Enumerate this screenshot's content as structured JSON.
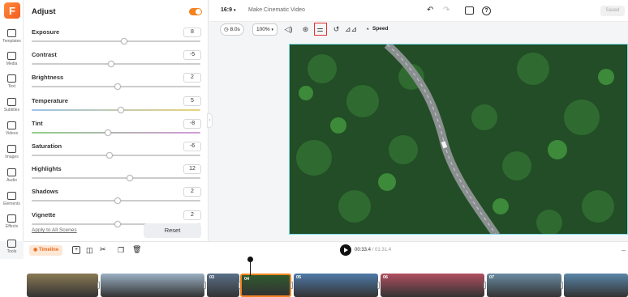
{
  "rail": [
    {
      "label": "Templates",
      "icon": "templates-icon"
    },
    {
      "label": "Media",
      "icon": "media-icon"
    },
    {
      "label": "Text",
      "icon": "text-icon"
    },
    {
      "label": "Subtitles",
      "icon": "subtitles-icon"
    },
    {
      "label": "Videos",
      "icon": "videos-icon"
    },
    {
      "label": "Images",
      "icon": "images-icon"
    },
    {
      "label": "Audio",
      "icon": "audio-icon"
    },
    {
      "label": "Elements",
      "icon": "elements-icon"
    },
    {
      "label": "Effects",
      "icon": "effects-icon"
    },
    {
      "label": "Tools",
      "icon": "tools-icon"
    }
  ],
  "logo": "F",
  "panel": {
    "title": "Adjust",
    "toggle_on": true,
    "rows": [
      {
        "label": "Exposure",
        "value": "8",
        "level": 0.55
      },
      {
        "label": "Contrast",
        "value": "-5",
        "level": 0.47
      },
      {
        "label": "Brightness",
        "value": "2",
        "level": 0.51
      },
      {
        "label": "Temperature",
        "value": "5",
        "level": 0.53
      },
      {
        "label": "Tint",
        "value": "-8",
        "level": 0.45
      },
      {
        "label": "Saturation",
        "value": "-6",
        "level": 0.46
      },
      {
        "label": "Highlights",
        "value": "12",
        "level": 0.58
      },
      {
        "label": "Shadows",
        "value": "2",
        "level": 0.51
      },
      {
        "label": "Vignette",
        "value": "2",
        "level": 0.51
      }
    ],
    "apply_all": "Apply to All Scenes",
    "reset": "Reset"
  },
  "topbar": {
    "ratio": "16:9",
    "project_title": "Make Cinematic Video",
    "saved": "Saved"
  },
  "toolbar": {
    "duration": "8.0s",
    "zoom": "100%",
    "speed": "Speed"
  },
  "timeline": {
    "label": "Timeline",
    "current_time": "00:33.4",
    "total_time": "01:31.4"
  },
  "clips": [
    {
      "num": "",
      "color": "#8a7a55"
    },
    {
      "num": "",
      "color": "#9ab0c4"
    },
    {
      "num": "03",
      "color": "#5a7088"
    },
    {
      "num": "04",
      "color": "#2f5a2e"
    },
    {
      "num": "05",
      "color": "#4f7aa8"
    },
    {
      "num": "06",
      "color": "#b05060"
    },
    {
      "num": "07",
      "color": "#6a8aa2"
    },
    {
      "num": "",
      "color": "#5a86a8"
    }
  ],
  "colors": {
    "accent": "#f5821f",
    "highlight": "#e5302d",
    "video_border": "#7ee0ea"
  }
}
